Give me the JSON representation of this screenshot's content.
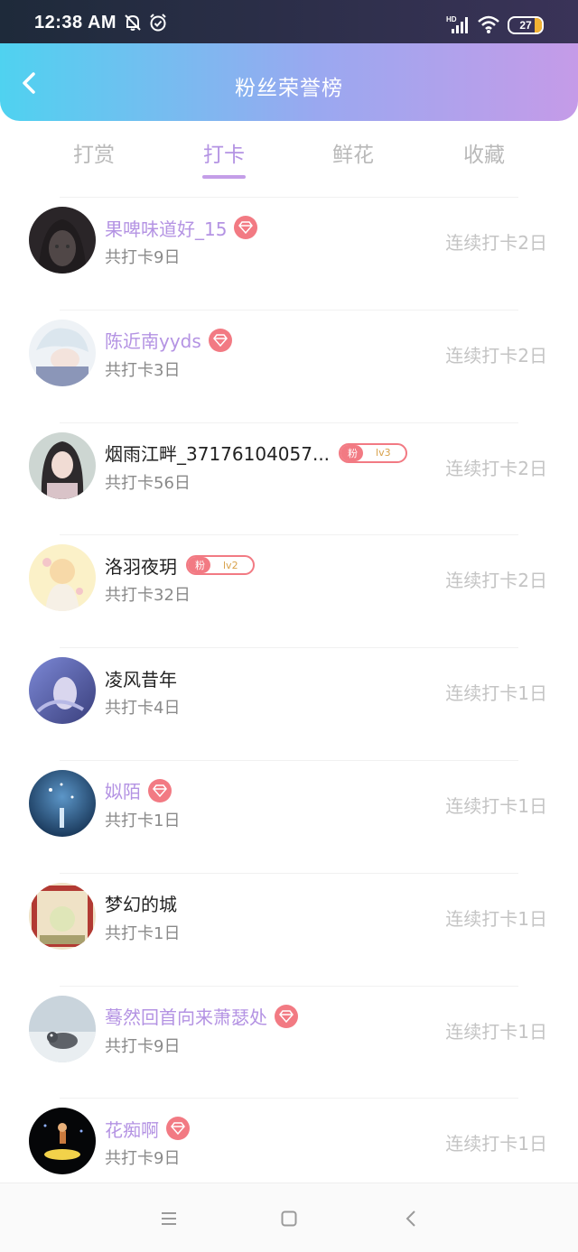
{
  "status_bar": {
    "time": "12:38 AM",
    "battery": "27",
    "icons": [
      "mute-bell-icon",
      "alarm-icon",
      "hd-signal-icon",
      "wifi-icon",
      "battery-icon"
    ]
  },
  "header": {
    "title": "粉丝荣誉榜",
    "back_icon": "chevron-left-icon"
  },
  "tabs": [
    {
      "label": "打赏",
      "active": false
    },
    {
      "label": "打卡",
      "active": true
    },
    {
      "label": "鲜花",
      "active": false
    },
    {
      "label": "收藏",
      "active": false
    }
  ],
  "list": [
    {
      "name": "果啤味道好_15",
      "vip": true,
      "badge": "diamond",
      "total": "共打卡9日",
      "streak": "连续打卡2日"
    },
    {
      "name": "陈近南yyds",
      "vip": true,
      "badge": "diamond",
      "total": "共打卡3日",
      "streak": "连续打卡2日"
    },
    {
      "name": "烟雨江畔_37176104057...",
      "vip": false,
      "badge": "fan",
      "fan_label": "粉",
      "fan_level": "lv3",
      "total": "共打卡56日",
      "streak": "连续打卡2日"
    },
    {
      "name": "洛羽夜玥",
      "vip": false,
      "badge": "fan",
      "fan_label": "粉",
      "fan_level": "lv2",
      "total": "共打卡32日",
      "streak": "连续打卡2日"
    },
    {
      "name": "凌风昔年",
      "vip": false,
      "badge": "none",
      "total": "共打卡4日",
      "streak": "连续打卡1日"
    },
    {
      "name": "姒陌",
      "vip": true,
      "badge": "diamond",
      "total": "共打卡1日",
      "streak": "连续打卡1日"
    },
    {
      "name": "梦幻的城",
      "vip": false,
      "badge": "none",
      "total": "共打卡1日",
      "streak": "连续打卡1日"
    },
    {
      "name": "蓦然回首向来萧瑟处",
      "vip": true,
      "badge": "diamond",
      "total": "共打卡9日",
      "streak": "连续打卡1日"
    },
    {
      "name": "花痴啊",
      "vip": true,
      "badge": "diamond",
      "total": "共打卡9日",
      "streak": "连续打卡1日"
    }
  ],
  "nav": [
    "menu-icon",
    "home-square-icon",
    "back-triangle-icon"
  ],
  "colors": {
    "accent": "#b493e3",
    "badge": "#f27a83",
    "muted": "#c4c4c4"
  }
}
